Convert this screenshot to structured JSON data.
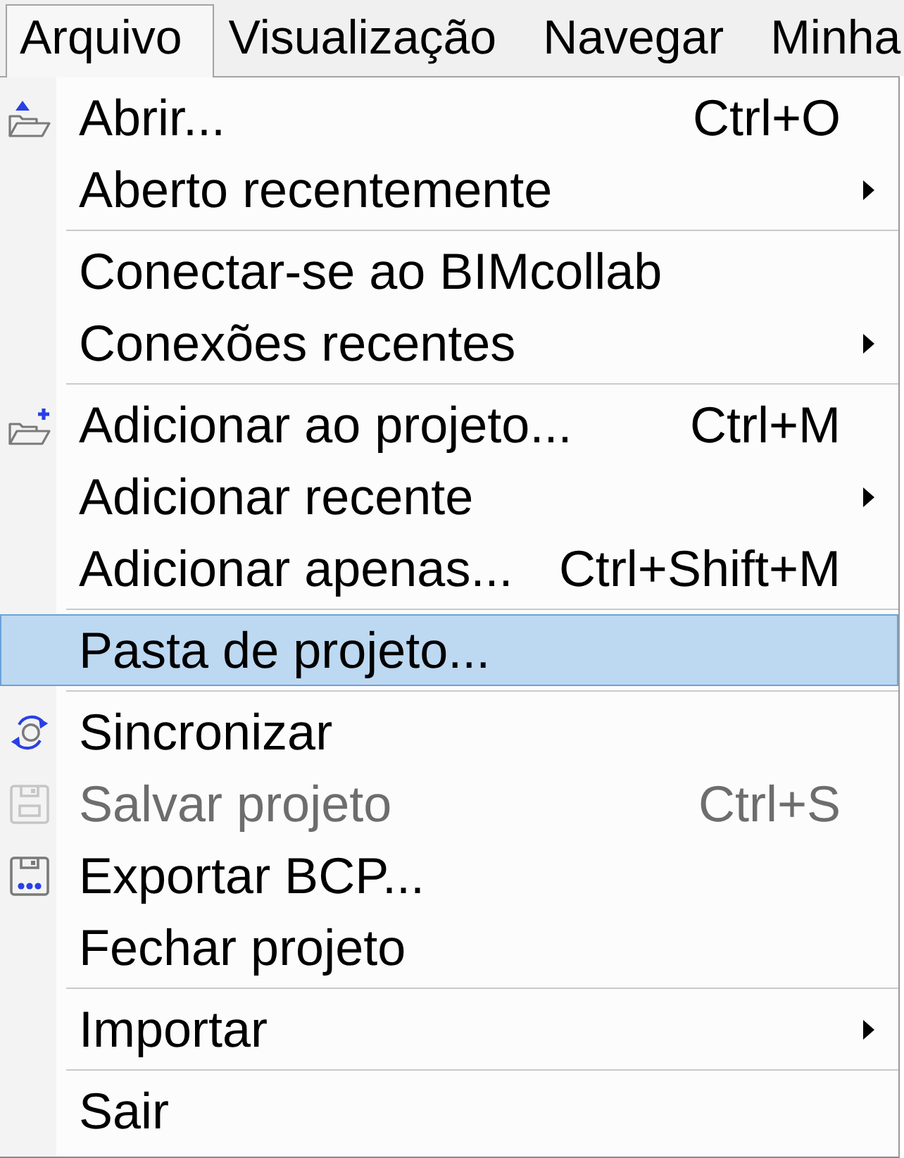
{
  "menubar": {
    "items": [
      {
        "label": "Arquivo",
        "selected": true
      },
      {
        "label": "Visualização",
        "selected": false
      },
      {
        "label": "Navegar",
        "selected": false
      },
      {
        "label": "Minha",
        "selected": false
      }
    ]
  },
  "menu": {
    "groups": [
      {
        "items": [
          {
            "label": "Abrir...",
            "shortcut": "Ctrl+O",
            "submenu": false,
            "disabled": false,
            "selected": false
          },
          {
            "label": "Aberto recentemente",
            "submenu": true,
            "disabled": false,
            "selected": false
          }
        ]
      },
      {
        "items": [
          {
            "label": "Conectar-se ao BIMcollab",
            "submenu": false,
            "disabled": false,
            "selected": false
          },
          {
            "label": "Conexões recentes",
            "submenu": true,
            "disabled": false,
            "selected": false
          }
        ]
      },
      {
        "items": [
          {
            "label": "Adicionar ao projeto...",
            "shortcut": "Ctrl+M",
            "submenu": false,
            "disabled": false,
            "selected": false
          },
          {
            "label": "Adicionar recente",
            "submenu": true,
            "disabled": false,
            "selected": false
          },
          {
            "label": "Adicionar apenas...",
            "shortcut": "Ctrl+Shift+M",
            "submenu": false,
            "disabled": false,
            "selected": false
          }
        ]
      },
      {
        "items": [
          {
            "label": "Pasta de projeto...",
            "submenu": false,
            "disabled": false,
            "selected": true
          }
        ]
      },
      {
        "items": [
          {
            "label": "Sincronizar",
            "submenu": false,
            "disabled": false,
            "selected": false
          },
          {
            "label": "Salvar projeto",
            "shortcut": "Ctrl+S",
            "submenu": false,
            "disabled": true,
            "selected": false
          },
          {
            "label": "Exportar BCP...",
            "submenu": false,
            "disabled": false,
            "selected": false
          },
          {
            "label": "Fechar projeto",
            "submenu": false,
            "disabled": false,
            "selected": false
          }
        ]
      },
      {
        "items": [
          {
            "label": "Importar",
            "submenu": true,
            "disabled": false,
            "selected": false
          }
        ]
      },
      {
        "items": [
          {
            "label": "Sair",
            "submenu": false,
            "disabled": false,
            "selected": false
          }
        ]
      }
    ]
  }
}
